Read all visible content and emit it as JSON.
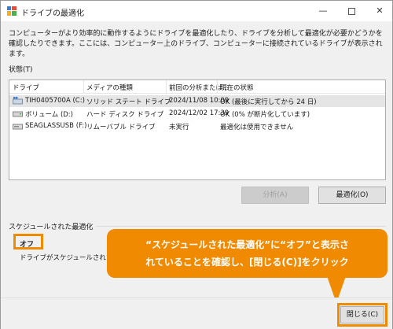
{
  "window": {
    "title": "ドライブの最適化",
    "icon": "defrag-icon",
    "controls": {
      "minimize": "—",
      "close": "✕"
    }
  },
  "description": "コンピューターがより効率的に動作するようにドライブを最適化したり、ドライブを分析して最適化が必要かどうかを確認したりできます。ここには、コンピューター上のドライブ、コンピューターに接続されているドライブが表示されます。",
  "status": {
    "label": "状態(T)",
    "columns": [
      "ドライブ",
      "メディアの種類",
      "前回の分析または...",
      "現在の状態"
    ],
    "rows": [
      {
        "icon": "windows-drive-icon",
        "drive": "TIH0405700A (C:)",
        "media": "ソリッド ステート ドライブ",
        "last": "2024/11/08 10:09",
        "state": "OK (最後に実行してから 24 日)",
        "selected": true
      },
      {
        "icon": "hard-disk-icon",
        "drive": "ボリューム (D:)",
        "media": "ハード ディスク ドライブ",
        "last": "2024/12/02 17:39",
        "state": "OK (0% が断片化しています)",
        "selected": false
      },
      {
        "icon": "usb-drive-icon",
        "drive": "SEAGLASSUSB (F:)",
        "media": "リムーバブル ドライブ",
        "last": "未実行",
        "state": "最適化は使用できません",
        "selected": false
      }
    ]
  },
  "buttons": {
    "analyze": "分析(A)",
    "optimize": "最適化(O)",
    "close": "閉じる(C)"
  },
  "schedule": {
    "title": "スケジュールされた最適化",
    "state": "オフ",
    "sub": "ドライブがスケジュールされた頻度"
  },
  "callout": {
    "line1": "“スケジュールされた最適化”に“オフ”と表示さ",
    "line2": "れていることを確認し、[閉じる(C)]をクリック"
  },
  "colors": {
    "highlight": "#f08a00",
    "selected_row": "#e5e5e5"
  }
}
